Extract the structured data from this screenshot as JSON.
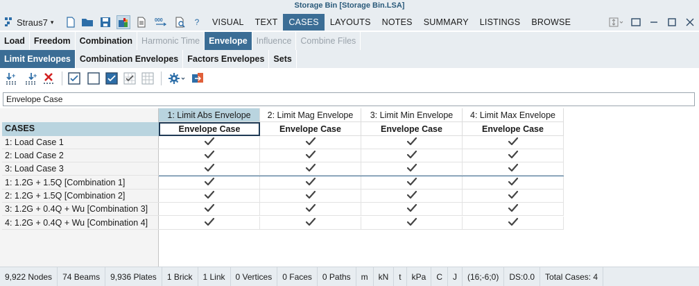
{
  "window": {
    "title": "Storage Bin [Storage Bin.LSA]",
    "app_menu_label": "Straus7"
  },
  "menu_tabs": [
    "VISUAL",
    "TEXT",
    "CASES",
    "LAYOUTS",
    "NOTES",
    "SUMMARY",
    "LISTINGS",
    "BROWSE"
  ],
  "active_menu_tab": "CASES",
  "subtabs_row1": [
    {
      "label": "Load",
      "state": "normal"
    },
    {
      "label": "Freedom",
      "state": "normal"
    },
    {
      "label": "Combination",
      "state": "normal"
    },
    {
      "label": "Harmonic Time",
      "state": "disabled"
    },
    {
      "label": "Envelope",
      "state": "active"
    },
    {
      "label": "Influence",
      "state": "disabled"
    },
    {
      "label": "Combine Files",
      "state": "disabled"
    }
  ],
  "subtabs_row2": [
    {
      "label": "Limit Envelopes",
      "state": "active"
    },
    {
      "label": "Combination Envelopes",
      "state": "normal"
    },
    {
      "label": "Factors Envelopes",
      "state": "normal"
    },
    {
      "label": "Sets",
      "state": "normal"
    }
  ],
  "envelope_case_field": {
    "value": "Envelope Case"
  },
  "grid": {
    "corner_header": "CASES",
    "columns": [
      {
        "title": "1: Limit Abs Envelope",
        "subheader": "Envelope Case",
        "selected": true
      },
      {
        "title": "2: Limit Mag Envelope",
        "subheader": "Envelope Case",
        "selected": false
      },
      {
        "title": "3: Limit Min Envelope",
        "subheader": "Envelope Case",
        "selected": false
      },
      {
        "title": "4: Limit Max Envelope",
        "subheader": "Envelope Case",
        "selected": false
      }
    ],
    "rows": [
      {
        "label": "1: Load Case 1",
        "checks": [
          true,
          true,
          true,
          true
        ]
      },
      {
        "label": "2: Load Case 2",
        "checks": [
          true,
          true,
          true,
          true
        ]
      },
      {
        "label": "3: Load Case 3",
        "checks": [
          true,
          true,
          true,
          true
        ]
      },
      {
        "label": "1: 1.2G + 1.5Q [Combination 1]",
        "checks": [
          true,
          true,
          true,
          true
        ]
      },
      {
        "label": "2: 1.2G + 1.5Q [Combination 2]",
        "checks": [
          true,
          true,
          true,
          true
        ]
      },
      {
        "label": "3: 1.2G + 0.4Q + Wu [Combination 3]",
        "checks": [
          true,
          true,
          true,
          true
        ]
      },
      {
        "label": "4: 1.2G + 0.4Q + Wu [Combination 4]",
        "checks": [
          true,
          true,
          true,
          true
        ]
      }
    ]
  },
  "statusbar": [
    "9,922 Nodes",
    "74 Beams",
    "9,936 Plates",
    "1 Brick",
    "1 Link",
    "0 Vertices",
    "0 Faces",
    "0 Paths",
    "m",
    "kN",
    "t",
    "kPa",
    "C",
    "J",
    "(16;-6;0)",
    "DS:0.0",
    "Total Cases: 4"
  ],
  "colors": {
    "accent": "#3b6d95",
    "selected_header": "#b9d4df",
    "chrome": "#e8edf1",
    "title_text": "#2a5a7a",
    "delete_red": "#d22020",
    "checkbox_blue": "#2d6ea8"
  },
  "icons": {
    "toolbar_main": [
      "new-file-icon",
      "open-folder-icon",
      "save-icon",
      "combinations-icon",
      "page-icon",
      "numbering-icon",
      "preview-icon",
      "help-icon"
    ],
    "icon_toolbar": [
      "add-case-icon",
      "insert-case-icon",
      "delete-case-icon",
      "check-all-icon",
      "uncheck-all-icon",
      "check-selected-icon",
      "check-grid-icon",
      "grid-icon",
      "settings-icon",
      "export-icon"
    ]
  }
}
